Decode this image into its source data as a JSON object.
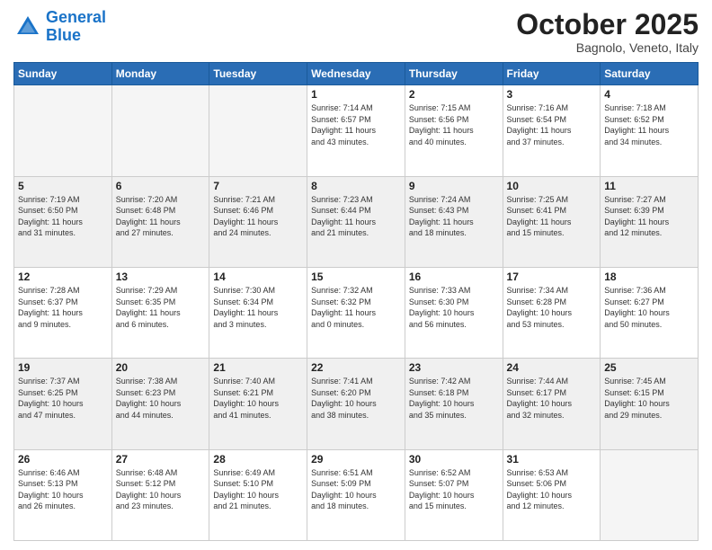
{
  "header": {
    "logo_line1": "General",
    "logo_line2": "Blue",
    "month": "October 2025",
    "location": "Bagnolo, Veneto, Italy"
  },
  "days_of_week": [
    "Sunday",
    "Monday",
    "Tuesday",
    "Wednesday",
    "Thursday",
    "Friday",
    "Saturday"
  ],
  "weeks": [
    [
      {
        "day": "",
        "info": ""
      },
      {
        "day": "",
        "info": ""
      },
      {
        "day": "",
        "info": ""
      },
      {
        "day": "1",
        "info": "Sunrise: 7:14 AM\nSunset: 6:57 PM\nDaylight: 11 hours\nand 43 minutes."
      },
      {
        "day": "2",
        "info": "Sunrise: 7:15 AM\nSunset: 6:56 PM\nDaylight: 11 hours\nand 40 minutes."
      },
      {
        "day": "3",
        "info": "Sunrise: 7:16 AM\nSunset: 6:54 PM\nDaylight: 11 hours\nand 37 minutes."
      },
      {
        "day": "4",
        "info": "Sunrise: 7:18 AM\nSunset: 6:52 PM\nDaylight: 11 hours\nand 34 minutes."
      }
    ],
    [
      {
        "day": "5",
        "info": "Sunrise: 7:19 AM\nSunset: 6:50 PM\nDaylight: 11 hours\nand 31 minutes."
      },
      {
        "day": "6",
        "info": "Sunrise: 7:20 AM\nSunset: 6:48 PM\nDaylight: 11 hours\nand 27 minutes."
      },
      {
        "day": "7",
        "info": "Sunrise: 7:21 AM\nSunset: 6:46 PM\nDaylight: 11 hours\nand 24 minutes."
      },
      {
        "day": "8",
        "info": "Sunrise: 7:23 AM\nSunset: 6:44 PM\nDaylight: 11 hours\nand 21 minutes."
      },
      {
        "day": "9",
        "info": "Sunrise: 7:24 AM\nSunset: 6:43 PM\nDaylight: 11 hours\nand 18 minutes."
      },
      {
        "day": "10",
        "info": "Sunrise: 7:25 AM\nSunset: 6:41 PM\nDaylight: 11 hours\nand 15 minutes."
      },
      {
        "day": "11",
        "info": "Sunrise: 7:27 AM\nSunset: 6:39 PM\nDaylight: 11 hours\nand 12 minutes."
      }
    ],
    [
      {
        "day": "12",
        "info": "Sunrise: 7:28 AM\nSunset: 6:37 PM\nDaylight: 11 hours\nand 9 minutes."
      },
      {
        "day": "13",
        "info": "Sunrise: 7:29 AM\nSunset: 6:35 PM\nDaylight: 11 hours\nand 6 minutes."
      },
      {
        "day": "14",
        "info": "Sunrise: 7:30 AM\nSunset: 6:34 PM\nDaylight: 11 hours\nand 3 minutes."
      },
      {
        "day": "15",
        "info": "Sunrise: 7:32 AM\nSunset: 6:32 PM\nDaylight: 11 hours\nand 0 minutes."
      },
      {
        "day": "16",
        "info": "Sunrise: 7:33 AM\nSunset: 6:30 PM\nDaylight: 10 hours\nand 56 minutes."
      },
      {
        "day": "17",
        "info": "Sunrise: 7:34 AM\nSunset: 6:28 PM\nDaylight: 10 hours\nand 53 minutes."
      },
      {
        "day": "18",
        "info": "Sunrise: 7:36 AM\nSunset: 6:27 PM\nDaylight: 10 hours\nand 50 minutes."
      }
    ],
    [
      {
        "day": "19",
        "info": "Sunrise: 7:37 AM\nSunset: 6:25 PM\nDaylight: 10 hours\nand 47 minutes."
      },
      {
        "day": "20",
        "info": "Sunrise: 7:38 AM\nSunset: 6:23 PM\nDaylight: 10 hours\nand 44 minutes."
      },
      {
        "day": "21",
        "info": "Sunrise: 7:40 AM\nSunset: 6:21 PM\nDaylight: 10 hours\nand 41 minutes."
      },
      {
        "day": "22",
        "info": "Sunrise: 7:41 AM\nSunset: 6:20 PM\nDaylight: 10 hours\nand 38 minutes."
      },
      {
        "day": "23",
        "info": "Sunrise: 7:42 AM\nSunset: 6:18 PM\nDaylight: 10 hours\nand 35 minutes."
      },
      {
        "day": "24",
        "info": "Sunrise: 7:44 AM\nSunset: 6:17 PM\nDaylight: 10 hours\nand 32 minutes."
      },
      {
        "day": "25",
        "info": "Sunrise: 7:45 AM\nSunset: 6:15 PM\nDaylight: 10 hours\nand 29 minutes."
      }
    ],
    [
      {
        "day": "26",
        "info": "Sunrise: 6:46 AM\nSunset: 5:13 PM\nDaylight: 10 hours\nand 26 minutes."
      },
      {
        "day": "27",
        "info": "Sunrise: 6:48 AM\nSunset: 5:12 PM\nDaylight: 10 hours\nand 23 minutes."
      },
      {
        "day": "28",
        "info": "Sunrise: 6:49 AM\nSunset: 5:10 PM\nDaylight: 10 hours\nand 21 minutes."
      },
      {
        "day": "29",
        "info": "Sunrise: 6:51 AM\nSunset: 5:09 PM\nDaylight: 10 hours\nand 18 minutes."
      },
      {
        "day": "30",
        "info": "Sunrise: 6:52 AM\nSunset: 5:07 PM\nDaylight: 10 hours\nand 15 minutes."
      },
      {
        "day": "31",
        "info": "Sunrise: 6:53 AM\nSunset: 5:06 PM\nDaylight: 10 hours\nand 12 minutes."
      },
      {
        "day": "",
        "info": ""
      }
    ]
  ],
  "row_shading": [
    false,
    true,
    false,
    true,
    false
  ]
}
